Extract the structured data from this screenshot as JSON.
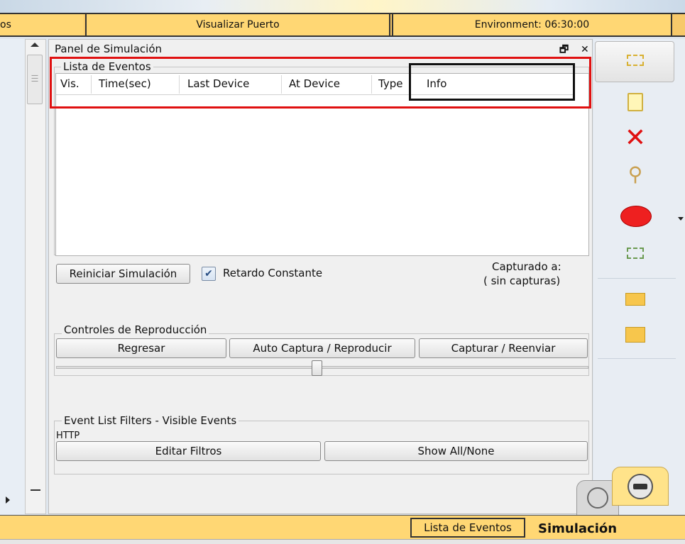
{
  "topbar": {
    "left_label": "os",
    "mid_label": "Visualizar Puerto",
    "right_label": "Environment: 06:30:00"
  },
  "panel": {
    "title": "Panel de Simulación",
    "controls": "🗗 ✕",
    "event_list": {
      "legend": "Lista de Eventos",
      "columns": [
        "Vis.",
        "Time(sec)",
        "Last Device",
        "At Device",
        "Type",
        "Info"
      ]
    },
    "reset_button": "Reiniciar Simulación",
    "constant_delay": {
      "label": "Retardo Constante",
      "checked": true
    },
    "captured_label": "Capturado a:",
    "captured_value": "( sin capturas)",
    "playback": {
      "legend": "Controles de Reproducción",
      "back_button": "Regresar",
      "auto_button": "Auto Captura / Reproducir",
      "capture_button": "Capturar / Reenviar",
      "slider_value": 0.49
    },
    "filters": {
      "legend": "Event List Filters - Visible Events",
      "protocols": "HTTP",
      "edit_button": "Editar Filtros",
      "show_all_button": "Show All/None"
    }
  },
  "toolbar": {
    "icons": [
      "select-icon",
      "note-icon",
      "delete-icon",
      "inspect-icon",
      "draw-ellipse-icon",
      "resize-icon",
      "add-simple-pdu-icon",
      "add-complex-pdu-icon"
    ],
    "colors": {
      "delete": "#e01010",
      "ellipse": "#ee2020",
      "accent": "#f7c64c"
    }
  },
  "bottombar": {
    "tab_label": "Lista de Eventos",
    "mode_label": "Simulación"
  },
  "highlight_colors": {
    "red_box": "#e01010",
    "black_box": "#111111"
  }
}
